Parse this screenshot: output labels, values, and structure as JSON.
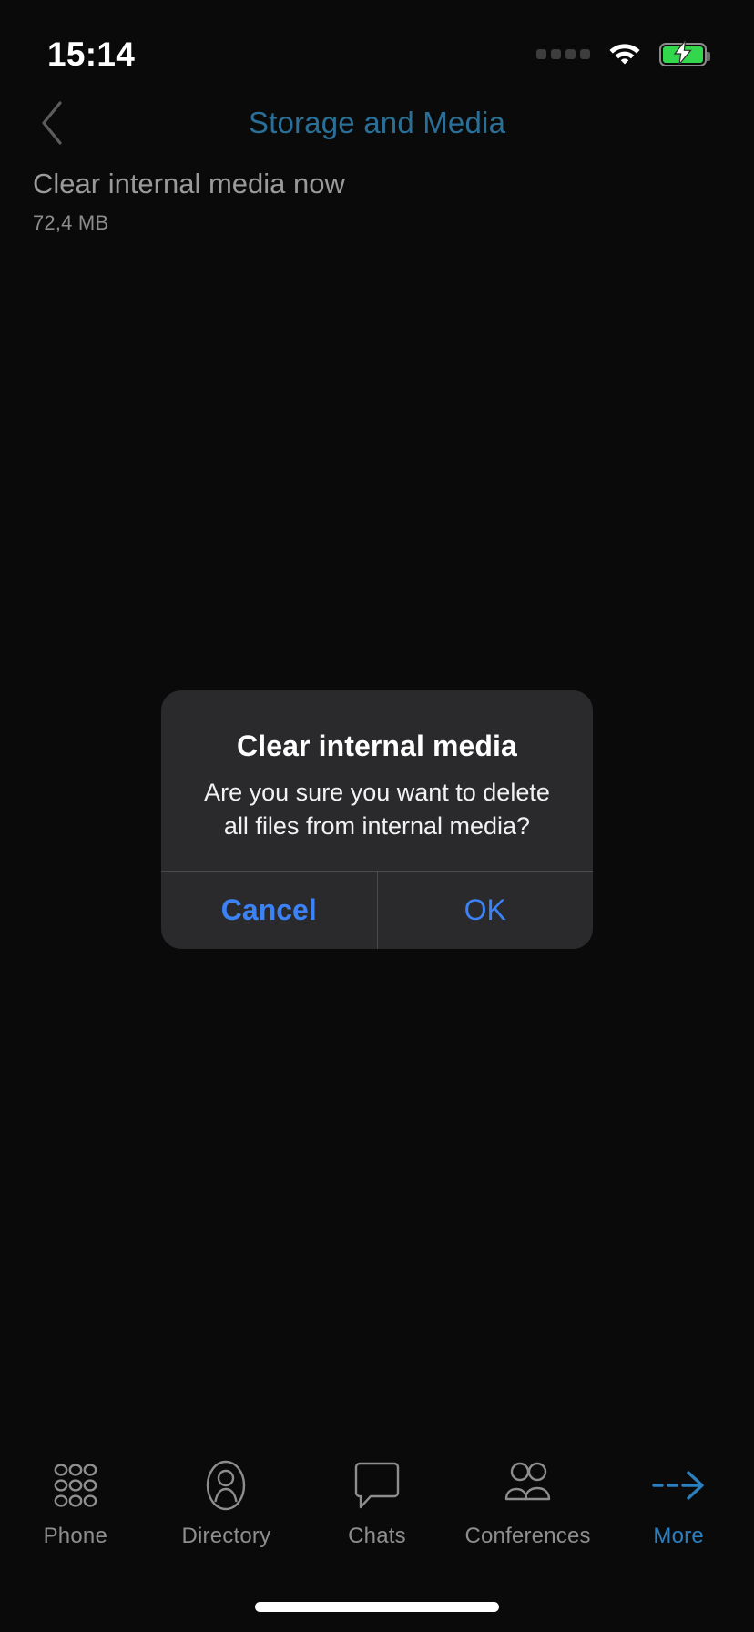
{
  "status_bar": {
    "time": "15:14",
    "signal_icon": "signal-dots-icon",
    "wifi_icon": "wifi-icon",
    "battery_icon": "battery-charging-icon",
    "battery_color": "#32d74b",
    "signal_dots": 4,
    "charging": true
  },
  "header": {
    "back_icon": "chevron-left-icon",
    "title": "Storage and Media",
    "title_color": "#2a6f97"
  },
  "content": {
    "rows": [
      {
        "title": "Clear internal media now",
        "subtitle": "72,4 MB"
      }
    ]
  },
  "dialog": {
    "visible": true,
    "title": "Clear internal media",
    "message": "Are you sure you want to delete all files from internal media?",
    "cancel_label": "Cancel",
    "ok_label": "OK",
    "button_color": "#3b82f6",
    "background_color": "#2a2a2c"
  },
  "tab_bar": {
    "active_color": "#2a7fbf",
    "inactive_color": "#8e8e8e",
    "tabs": [
      {
        "label": "Phone",
        "icon": "dialpad-icon",
        "active": false
      },
      {
        "label": "Directory",
        "icon": "contact-icon",
        "active": false
      },
      {
        "label": "Chats",
        "icon": "chat-bubble-icon",
        "active": false
      },
      {
        "label": "Conferences",
        "icon": "group-icon",
        "active": false
      },
      {
        "label": "More",
        "icon": "arrow-right-dashed-icon",
        "active": true
      }
    ]
  },
  "home_indicator": {
    "visible": true
  }
}
